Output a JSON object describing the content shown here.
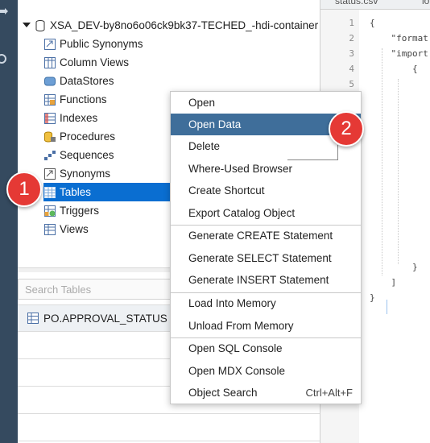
{
  "tree": {
    "root_label": "XSA_DEV-by8no6o06ck9bk37-TECHED_-hdi-container",
    "items": [
      {
        "label": "Public Synonyms",
        "icon": "public-synonyms-icon"
      },
      {
        "label": "Column Views",
        "icon": "column-views-icon"
      },
      {
        "label": "DataStores",
        "icon": "datastores-icon"
      },
      {
        "label": "Functions",
        "icon": "functions-icon"
      },
      {
        "label": "Indexes",
        "icon": "indexes-icon"
      },
      {
        "label": "Procedures",
        "icon": "procedures-icon"
      },
      {
        "label": "Sequences",
        "icon": "sequences-icon"
      },
      {
        "label": "Synonyms",
        "icon": "synonyms-icon"
      },
      {
        "label": "Tables",
        "icon": "tables-icon",
        "selected": true
      },
      {
        "label": "Triggers",
        "icon": "triggers-icon"
      },
      {
        "label": "Views",
        "icon": "views-icon"
      }
    ]
  },
  "search": {
    "placeholder": "Search Tables"
  },
  "results": [
    {
      "label": "PO.APPROVAL_STATUS"
    }
  ],
  "editor": {
    "tabs": [
      "status.csv",
      "lo"
    ],
    "line_numbers": [
      "1",
      "2",
      "3",
      "4",
      "5",
      "6"
    ],
    "lines": [
      "{",
      "    \"format",
      "    \"import",
      "        {",
      "",
      "",
      "        }",
      "    ]",
      "}"
    ]
  },
  "context_menu": {
    "items": [
      {
        "label": "Open"
      },
      {
        "label": "Open Data",
        "active": true
      },
      {
        "label": "Delete"
      },
      {
        "label": "Where-Used Browser"
      },
      {
        "label": "Create Shortcut"
      },
      {
        "label": "Export Catalog Object"
      },
      {
        "label": "Generate CREATE Statement"
      },
      {
        "label": "Generate SELECT Statement"
      },
      {
        "label": "Generate INSERT Statement"
      },
      {
        "label": "Load Into Memory"
      },
      {
        "label": "Unload From Memory"
      },
      {
        "label": "Open SQL Console"
      },
      {
        "label": "Open MDX Console"
      },
      {
        "label": "Object Search",
        "shortcut": "Ctrl+Alt+F"
      }
    ]
  },
  "badges": {
    "step1": "1",
    "step2": "2"
  },
  "colors": {
    "selection": "#0a6ed1",
    "menu_active": "#3f6e9a",
    "badge": "#e53935",
    "leftbar": "#354a5f"
  }
}
